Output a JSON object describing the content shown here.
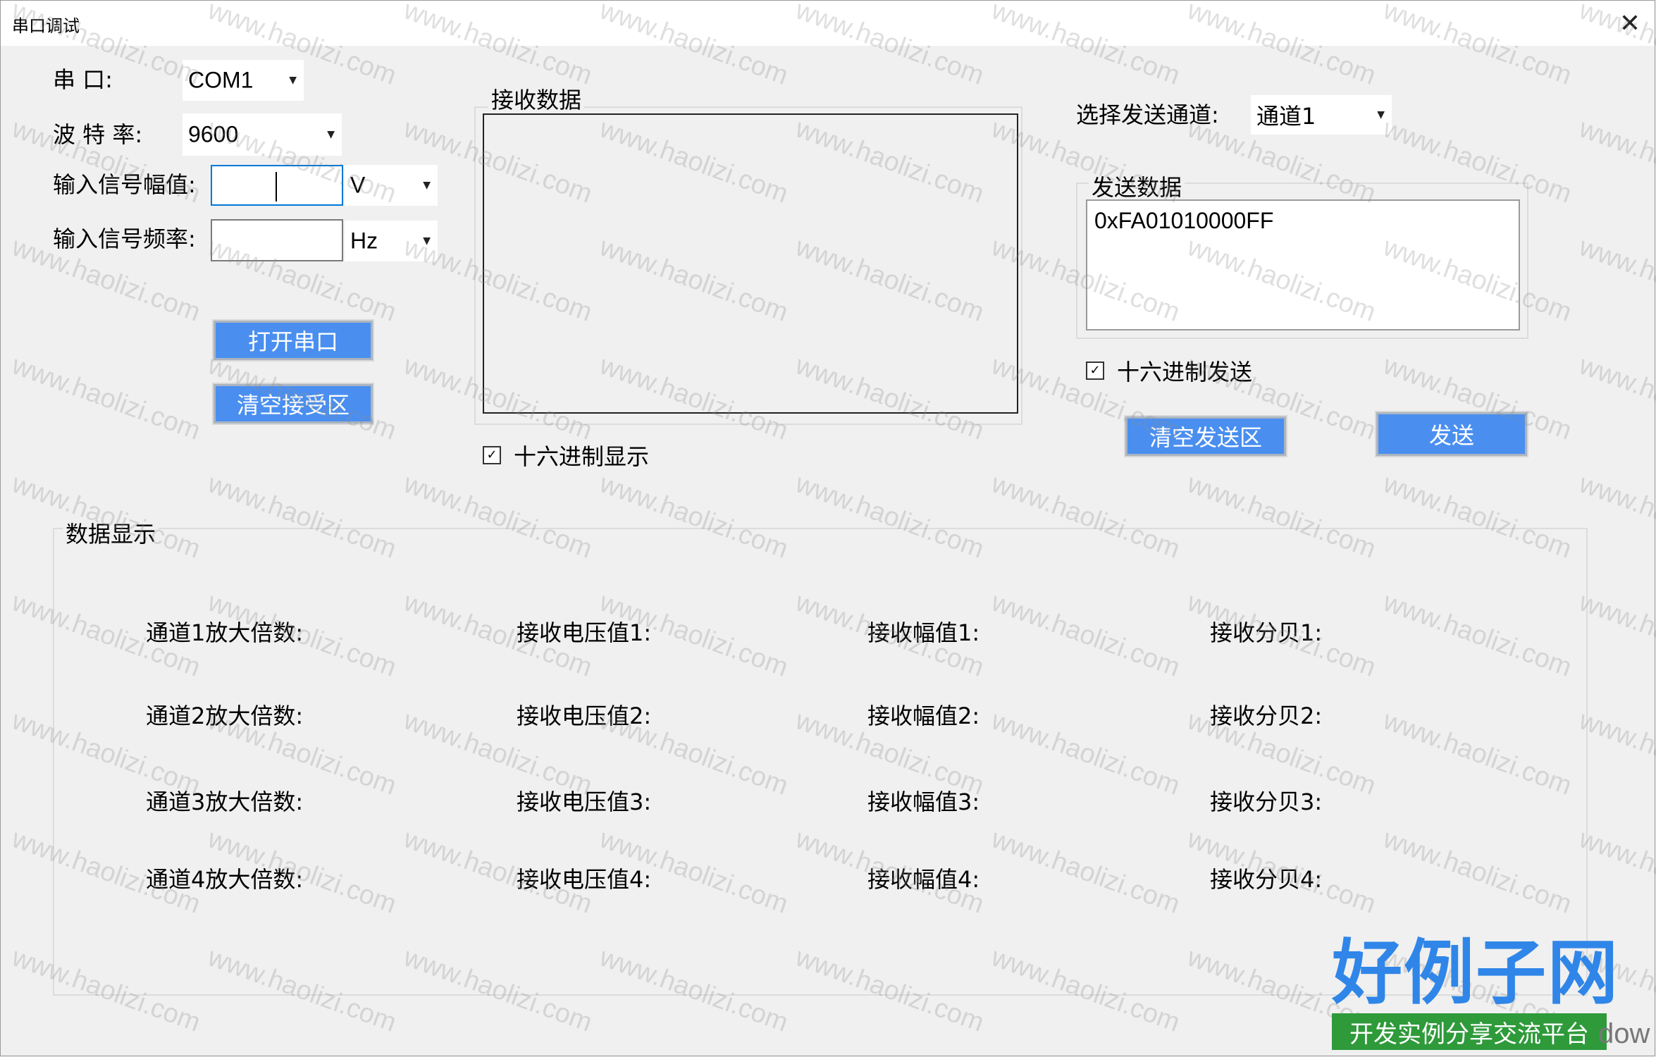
{
  "window": {
    "title": "串口调试"
  },
  "serial": {
    "port_label": "串    口:",
    "port_value": "COM1",
    "baud_label": "波 特 率:",
    "baud_value": "9600",
    "amp_label": "输入信号幅值:",
    "amp_unit": "V",
    "freq_label": "输入信号频率:",
    "freq_unit": "Hz",
    "open_button": "打开串口",
    "clear_receive_button": "清空接受区"
  },
  "receive": {
    "group_title": "接收数据",
    "hex_display_label": "十六进制显示",
    "hex_display_checked": true
  },
  "send": {
    "channel_label": "选择发送通道:",
    "channel_value": "通道1",
    "group_title": "发送数据",
    "data_value": "0xFA01010000FF",
    "hex_send_label": "十六进制发送",
    "hex_send_checked": true,
    "clear_send_button": "清空发送区",
    "send_button": "发送"
  },
  "display": {
    "group_title": "数据显示",
    "rows": [
      {
        "gain": "通道1放大倍数:",
        "voltage": "接收电压值1:",
        "amplitude": "接收幅值1:",
        "db": "接收分贝1:"
      },
      {
        "gain": "通道2放大倍数:",
        "voltage": "接收电压值2:",
        "amplitude": "接收幅值2:",
        "db": "接收分贝2:"
      },
      {
        "gain": "通道3放大倍数:",
        "voltage": "接收电压值3:",
        "amplitude": "接收幅值3:",
        "db": "接收分贝3:"
      },
      {
        "gain": "通道4放大倍数:",
        "voltage": "接收电压值4:",
        "amplitude": "接收幅值4:",
        "db": "接收分贝4:"
      }
    ]
  },
  "watermark": {
    "text": "www.haolizi.com"
  },
  "logo": {
    "main": "好例子网",
    "sub": "开发实例分享交流平台"
  },
  "corner_text": "dow",
  "colors": {
    "button": "#4a8ff0",
    "logo_blue": "#2f86e8",
    "logo_green": "#2e9a3a"
  },
  "icons": {
    "close": "close-icon",
    "dropdown": "chevron-down-icon",
    "check": "checkmark-icon"
  }
}
